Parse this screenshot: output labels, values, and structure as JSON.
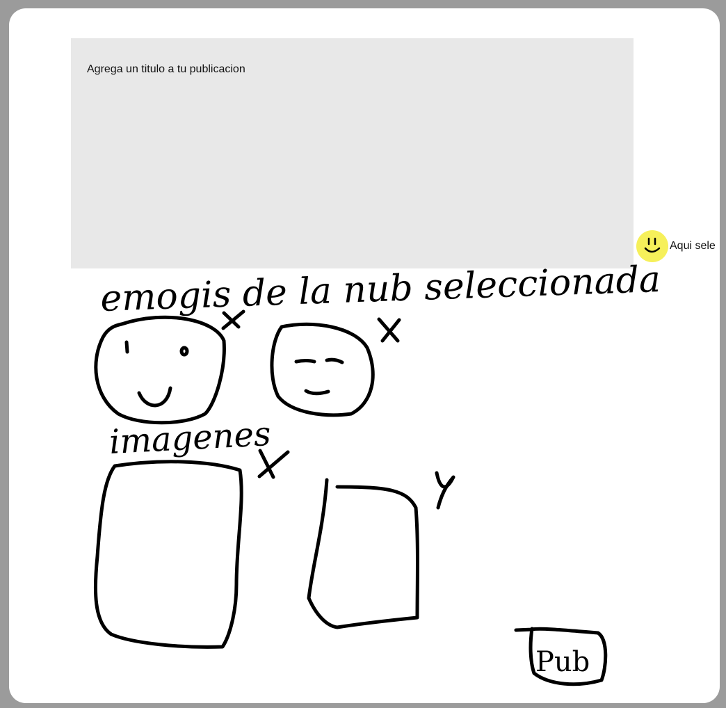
{
  "post": {
    "title_placeholder": "Agrega un titulo a tu publicacion"
  },
  "emoji_picker": {
    "icon": "smiley-face-icon",
    "label": "Aqui sele",
    "color": "#f6f05a"
  },
  "sketch": {
    "emojis_note": "emogis de la nub seleccionada",
    "images_note": "imagenes",
    "publish_label": "Pub"
  },
  "colors": {
    "backdrop": "#9b9b9b",
    "card": "#ffffff",
    "title_box": "#e8e8e8"
  }
}
